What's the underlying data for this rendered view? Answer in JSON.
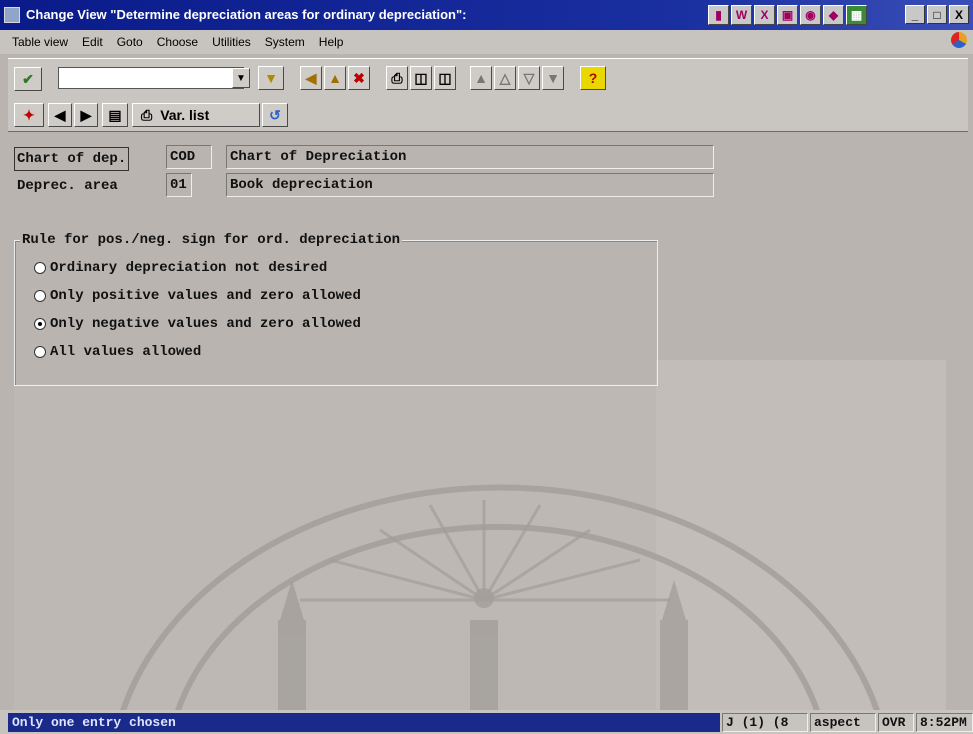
{
  "window": {
    "title": "Change View \"Determine depreciation areas for ordinary depreciation\":",
    "controls": {
      "minimize": "_",
      "maximize": "□",
      "close": "X"
    }
  },
  "menubar": [
    "Table view",
    "Edit",
    "Goto",
    "Choose",
    "Utilities",
    "System",
    "Help"
  ],
  "toolbar": {
    "command_field_value": "",
    "help_label": "?"
  },
  "app_toolbar": {
    "var_list_label": "Var. list"
  },
  "fields": {
    "chart_of_dep": {
      "label": "Chart of dep.",
      "code": "COD",
      "description": "Chart of Depreciation"
    },
    "deprec_area": {
      "label": "Deprec. area",
      "code": "01",
      "description": "Book depreciation"
    }
  },
  "sign_rule": {
    "title": "Rule for pos./neg. sign for ord. depreciation",
    "options": [
      {
        "label": "Ordinary depreciation not desired",
        "selected": false
      },
      {
        "label": "Only positive values and zero allowed",
        "selected": false
      },
      {
        "label": "Only negative values and zero allowed",
        "selected": true
      },
      {
        "label": "All values allowed",
        "selected": false
      }
    ]
  },
  "statusbar": {
    "message": "Only one entry chosen",
    "session": "J (1) (8",
    "server": "aspect",
    "mode": "OVR",
    "time": "8:52PM"
  },
  "colors": {
    "title_bar": "#0a1a8a",
    "status_message_bg": "#1a2a8a",
    "background": "#b9b4b0"
  }
}
